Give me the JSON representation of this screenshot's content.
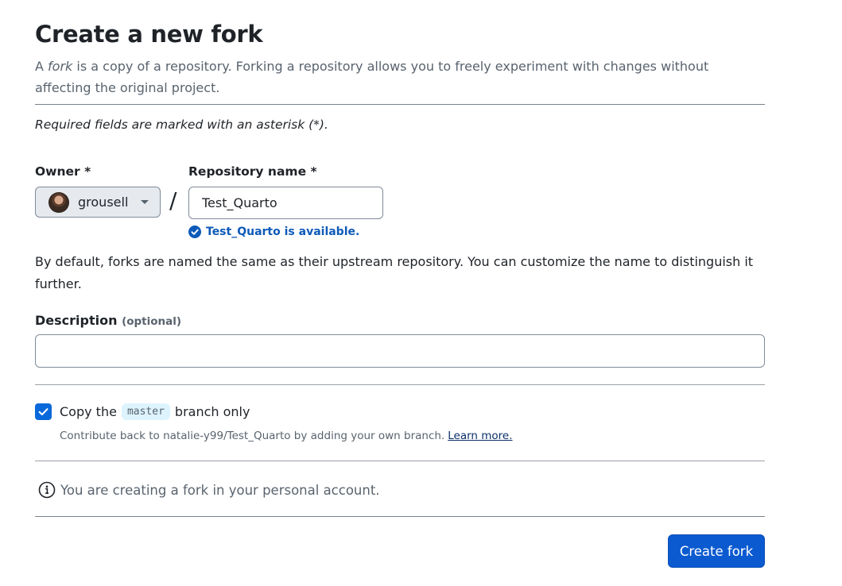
{
  "header": {
    "title": "Create a new fork",
    "subtitle_prefix": "A ",
    "subtitle_em": "fork",
    "subtitle_rest": " is a copy of a repository. Forking a repository allows you to freely experiment with changes without affecting the original project."
  },
  "required_note": "Required fields are marked with an asterisk (*).",
  "owner": {
    "label": "Owner *",
    "value": "grousell",
    "icon": "avatar"
  },
  "separator": "/",
  "repository": {
    "label": "Repository name *",
    "value": "Test_Quarto",
    "availability": "Test_Quarto is available.",
    "availability_color": "#0d5ab8"
  },
  "naming_hint": "By default, forks are named the same as their upstream repository. You can customize the name to distinguish it further.",
  "description": {
    "label": "Description",
    "optional": "(optional)",
    "value": ""
  },
  "copy_branch": {
    "checked": true,
    "prefix": "Copy the",
    "branch": "master",
    "suffix": "branch only",
    "contribute_text": "Contribute back to natalie-y99/Test_Quarto by adding your own branch.",
    "learn_more": "Learn more."
  },
  "info": {
    "text": "You are creating a fork in your personal account.",
    "icon": "info-icon"
  },
  "submit": {
    "label": "Create fork",
    "color": "#0b5ad0"
  }
}
